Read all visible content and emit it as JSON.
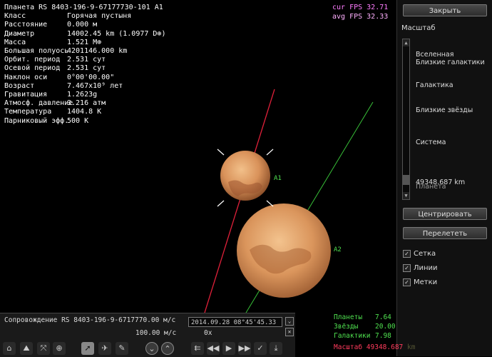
{
  "info": {
    "title": "Планета  RS 8403-196-9-67177730-101 A1",
    "rows": [
      {
        "k": "Класс",
        "v": "Горячая пустыня"
      },
      {
        "k": "Расстояние",
        "v": "0.000 м"
      },
      {
        "k": "Диаметр",
        "v": "14002.45 km (1.0977 D⊕)"
      },
      {
        "k": "Масса",
        "v": "1.521 M⊕"
      },
      {
        "k": "Большая полуось",
        "v": "4201146.000 km"
      },
      {
        "k": "Орбит. период",
        "v": "2.531 сут"
      },
      {
        "k": "Осевой период",
        "v": "2.531 сут"
      },
      {
        "k": "Наклон оси",
        "v": "0°00'00.00\""
      },
      {
        "k": "Возраст",
        "v": "7.467x10⁹ лет"
      },
      {
        "k": "Гравитация",
        "v": "1.2623g"
      },
      {
        "k": "Атмосф. давление",
        "v": "3.216 атм"
      },
      {
        "k": "Температура",
        "v": "1404.8 K"
      },
      {
        "k": "Парниковый эфф.",
        "v": "500 K"
      }
    ]
  },
  "fps": {
    "cur": "cur FPS 32.71",
    "avg": "avg FPS 32.33"
  },
  "scene": {
    "label_a1": "A1",
    "label_a2": "A2",
    "planet_color": "#d8945a",
    "label_color": "#4fe04f",
    "orbit_red": "#e0203a",
    "orbit_green": "#38c038"
  },
  "panel": {
    "close": "Закрыть",
    "scale_title": "Масштаб",
    "levels": [
      "Вселенная",
      "Близкие галактики",
      "Галактика",
      "Близкие звёзды",
      "Система",
      "Планета"
    ],
    "scale_value": "49348.687 km",
    "center": "Центрировать",
    "fly": "Перелететь",
    "checks": [
      {
        "label": "Сетка",
        "checked": true
      },
      {
        "label": "Линии",
        "checked": true
      },
      {
        "label": "Метки",
        "checked": true
      }
    ]
  },
  "bottom": {
    "follow": "Сопровождение RS 8403-196-9-6717770.00 м/с",
    "speed": "100.00  м/с",
    "date": "2014.09.28  08°45'45.33",
    "timescale": "0x"
  },
  "stats": {
    "planets_k": "Планеты",
    "planets_v": "7.64",
    "stars_k": "Звёзды",
    "stars_v": "20.00",
    "galaxies_k": "Галактики",
    "galaxies_v": "7.98",
    "scale_k": "Масштаб",
    "scale_v": "49348.687",
    "scale_unit": "km"
  }
}
